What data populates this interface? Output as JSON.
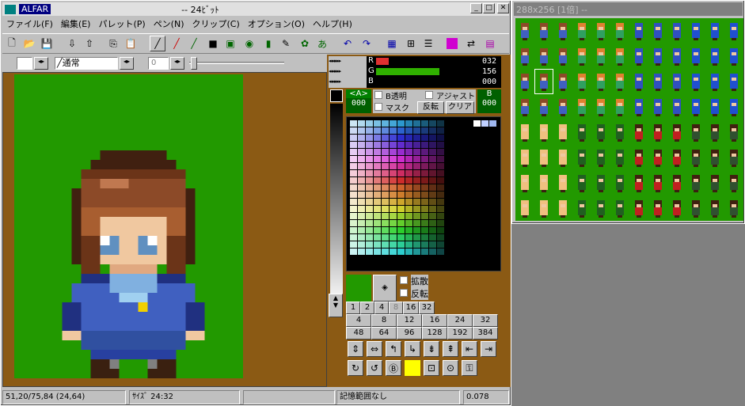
{
  "main_window": {
    "app_name": "ALFAR",
    "title": "-- 24ﾋﾞｯﾄ",
    "menu": [
      "ファイル(F)",
      "編集(E)",
      "パレット(P)",
      "ペン(N)",
      "クリップ(C)",
      "オプション(O)",
      "ヘルプ(H)"
    ],
    "brush_mode": "通常",
    "brush_value": "0",
    "rgb": {
      "r_label": "R",
      "g_label": "G",
      "b_label": "B",
      "r": "032",
      "g": "156",
      "b": "000"
    },
    "alpha_label": "<A>",
    "alpha_value": "000",
    "b_label": "B",
    "b_value": "000",
    "b_transparent": "B透明",
    "adjust": "アジャスト",
    "mask": "マスク",
    "invert_btn": "反転",
    "clear_btn": "クリア",
    "spread": "拡散",
    "flip": "反転",
    "grid_row1": [
      "1",
      "2",
      "4",
      "8",
      "16",
      "32"
    ],
    "grid_row2": [
      "4",
      "8",
      "12",
      "16",
      "24",
      "32"
    ],
    "grid_row3": [
      "48",
      "64",
      "96",
      "128",
      "192",
      "384"
    ],
    "status": {
      "coords": "51,20/75,84 (24,64)",
      "size": "ｻｲｽﾞ 24:32",
      "range": "記憶範囲なし",
      "zoom": "0.078"
    }
  },
  "sheet_window": {
    "title": "288x256 [1倍] --"
  },
  "colors": {
    "canvas_green": "#229900",
    "bg_brown": "#8b5a14",
    "titlebar_active": "#000080",
    "titlebar_inactive": "#808080",
    "r_bar": "#e03030",
    "g_bar": "#30b000"
  },
  "icons": [
    "new-file-icon",
    "open-icon",
    "save-icon",
    "import-icon",
    "export-icon",
    "copy-icon",
    "paste-icon",
    "pen-icon",
    "line-icon",
    "rect-icon",
    "fill-rect-icon",
    "ellipse-icon",
    "fill-icon",
    "spray-icon",
    "stamp-icon",
    "text-icon",
    "undo-icon",
    "redo-icon",
    "grid-icon",
    "zoom-icon",
    "palette-icon",
    "color-icon",
    "swap-icon"
  ]
}
